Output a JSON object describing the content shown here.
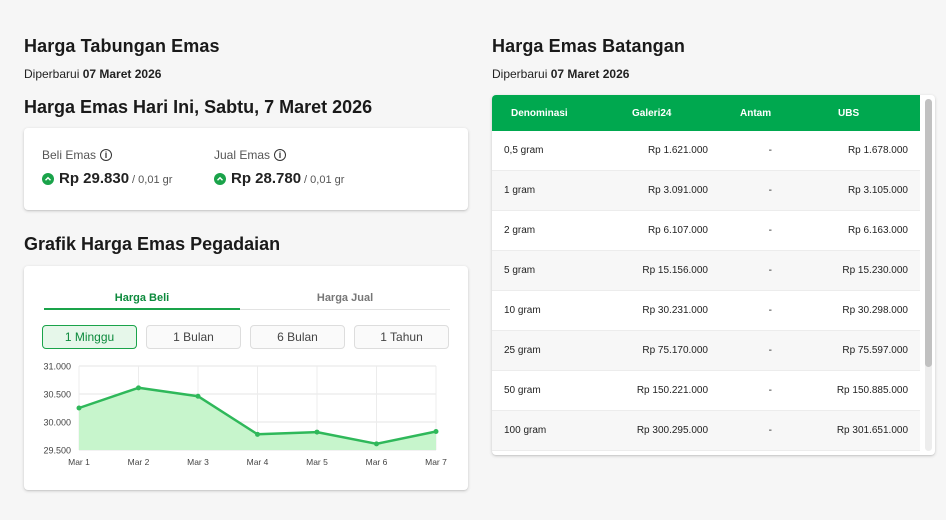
{
  "tabungan": {
    "title": "Harga Tabungan Emas",
    "updated_prefix": "Diperbarui",
    "updated_date": "07 Maret 2026",
    "today_title": "Harga Emas Hari Ini, Sabtu, 7 Maret 2026",
    "buy": {
      "label": "Beli Emas",
      "price": "Rp 29.830",
      "unit": "/ 0,01 gr"
    },
    "sell": {
      "label": "Jual Emas",
      "price": "Rp 28.780",
      "unit": "/ 0,01 gr"
    },
    "info_icon": "info-icon",
    "trend_icon": "chevron-up-icon"
  },
  "grafik": {
    "title": "Grafik Harga Emas Pegadaian",
    "tabs": [
      {
        "label": "Harga Beli",
        "active": true
      },
      {
        "label": "Harga Jual",
        "active": false
      }
    ],
    "periods": [
      {
        "label": "1 Minggu",
        "active": true
      },
      {
        "label": "1 Bulan",
        "active": false
      },
      {
        "label": "6 Bulan",
        "active": false
      },
      {
        "label": "1 Tahun",
        "active": false
      }
    ]
  },
  "chart_data": {
    "type": "area",
    "categories": [
      "Mar 1",
      "Mar 2",
      "Mar 3",
      "Mar 4",
      "Mar 5",
      "Mar 6",
      "Mar 7"
    ],
    "values": [
      30250,
      30610,
      30460,
      29780,
      29820,
      29610,
      29830
    ],
    "ylim": [
      29500,
      31000
    ],
    "yticks": [
      "29.500",
      "30.000",
      "30.500",
      "31.000"
    ],
    "ytick_values": [
      29500,
      30000,
      30500,
      31000
    ],
    "grid": true,
    "line_color": "#2fb85a",
    "fill_color": "#c7f5cc"
  },
  "batangan": {
    "title": "Harga Emas Batangan",
    "updated_prefix": "Diperbarui",
    "updated_date": "07 Maret 2026",
    "columns": [
      "Denominasi",
      "Galeri24",
      "Antam",
      "UBS"
    ],
    "rows": [
      [
        "0,5 gram",
        "Rp 1.621.000",
        "-",
        "Rp 1.678.000"
      ],
      [
        "1 gram",
        "Rp 3.091.000",
        "-",
        "Rp 3.105.000"
      ],
      [
        "2 gram",
        "Rp 6.107.000",
        "-",
        "Rp 6.163.000"
      ],
      [
        "5 gram",
        "Rp 15.156.000",
        "-",
        "Rp 15.230.000"
      ],
      [
        "10 gram",
        "Rp 30.231.000",
        "-",
        "Rp 30.298.000"
      ],
      [
        "25 gram",
        "Rp 75.170.000",
        "-",
        "Rp 75.597.000"
      ],
      [
        "50 gram",
        "Rp 150.221.000",
        "-",
        "Rp 150.885.000"
      ],
      [
        "100 gram",
        "Rp 300.295.000",
        "-",
        "Rp 301.651.000"
      ]
    ],
    "header_color": "#00a84f"
  }
}
